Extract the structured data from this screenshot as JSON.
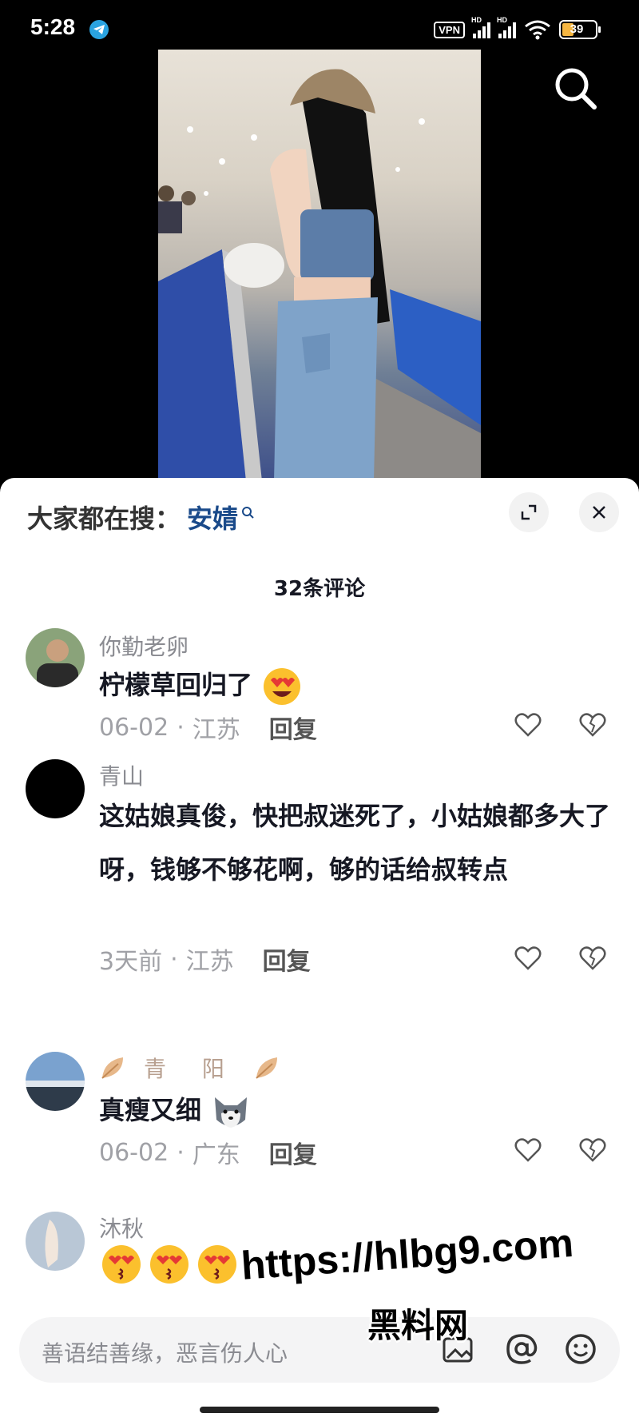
{
  "status_bar": {
    "time": "5:28",
    "vpn": "VPN",
    "signal_label": "HD",
    "battery": "39"
  },
  "video": {
    "search_icon": "search-icon"
  },
  "panel": {
    "hot_search_prefix": "大家都在搜：",
    "hot_search_term": "安婧",
    "comment_count": "32条评论"
  },
  "comments": [
    {
      "user": "你勤老卵",
      "text": "柠檬草回归了",
      "date": "06-02",
      "location": "江苏",
      "reply": "回复",
      "emoji": "heart-eyes"
    },
    {
      "user": "青山",
      "text": "这姑娘真俊，快把叔迷死了，小姑娘都多大了呀，钱够不够花啊，够的话给叔转点",
      "date": "3天前",
      "location": "江苏",
      "reply": "回复"
    },
    {
      "user": "青 阳",
      "text": "真瘦又细",
      "date": "06-02",
      "location": "广东",
      "reply": "回复",
      "emoji": "husky"
    },
    {
      "user": "沐秋",
      "emoji": "kiss-hearts"
    }
  ],
  "input": {
    "placeholder": "善语结善缘，恶言伤人心"
  },
  "watermark": {
    "url": "https://hlbg9.com",
    "name": "黑料网"
  },
  "colors": {
    "accent": "#1a4a8a",
    "battery": "#f5b642"
  }
}
